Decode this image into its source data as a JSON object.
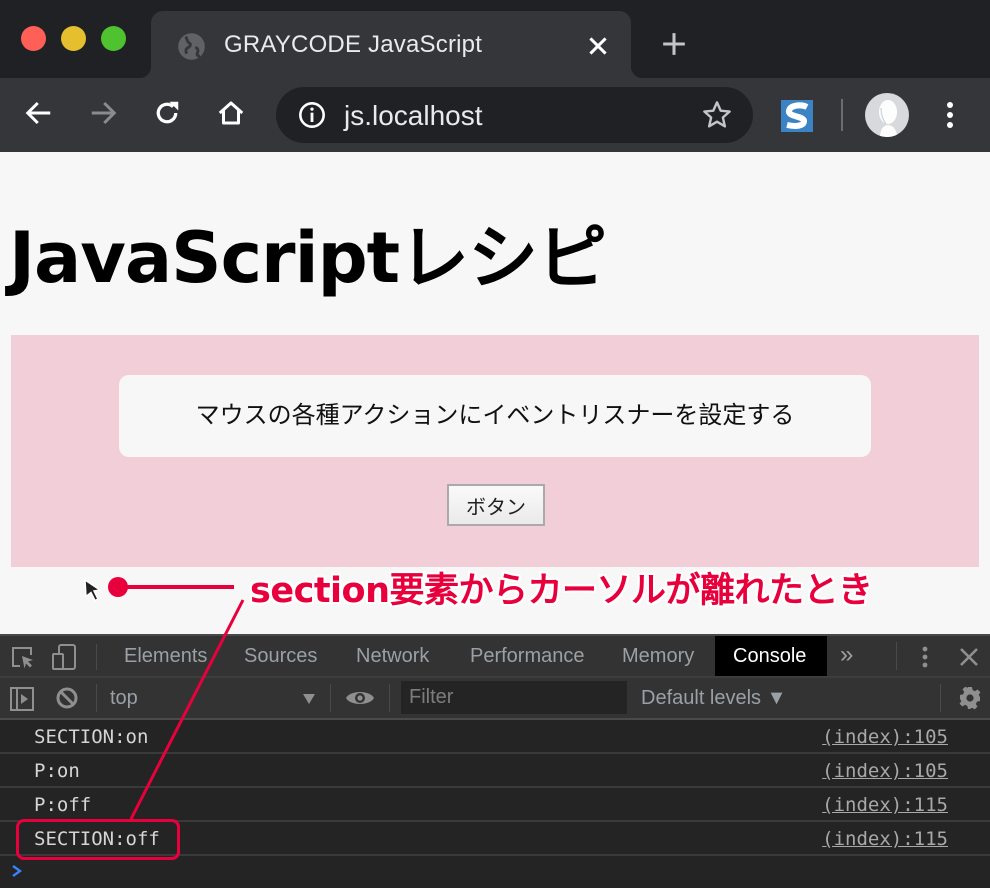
{
  "window": {
    "controls": [
      "close",
      "minimize",
      "zoom"
    ]
  },
  "tab": {
    "title": "GRAYCODE JavaScript",
    "favicon": "globe-icon",
    "close_icon": "close-icon",
    "new_tab_icon": "plus-icon"
  },
  "toolbar": {
    "back_icon": "arrow-left-icon",
    "forward_icon": "arrow-right-icon",
    "reload_icon": "reload-icon",
    "home_icon": "home-icon",
    "info_icon": "info-icon",
    "url": "js.localhost",
    "bookmark_icon": "star-icon",
    "extension_icon": "s-extension-icon",
    "profile_icon": "avatar-icon",
    "menu_icon": "kebab-icon"
  },
  "page": {
    "title": "JavaScriptレシピ",
    "paragraph": "マウスの各種アクションにイベントリスナーを設定する",
    "button_label": "ボタン",
    "section_color": "#f1ced8"
  },
  "annotation": {
    "text": "section要素からカーソルが離れたとき",
    "color": "#e8003c"
  },
  "devtools": {
    "tabs": [
      {
        "label": "Elements",
        "active": false
      },
      {
        "label": "Sources",
        "active": false
      },
      {
        "label": "Network",
        "active": false
      },
      {
        "label": "Performance",
        "active": false
      },
      {
        "label": "Memory",
        "active": false
      },
      {
        "label": "Console",
        "active": true
      }
    ],
    "more_tabs": "»",
    "context": "top",
    "filter_placeholder": "Filter",
    "filter_value": "",
    "levels": "Default levels ▼",
    "logs": [
      {
        "message": "SECTION:on",
        "source": "(index):105"
      },
      {
        "message": "P:on",
        "source": "(index):105"
      },
      {
        "message": "P:off",
        "source": "(index):115"
      },
      {
        "message": "SECTION:off",
        "source": "(index):115",
        "highlighted": true
      }
    ],
    "prompt": ">"
  }
}
